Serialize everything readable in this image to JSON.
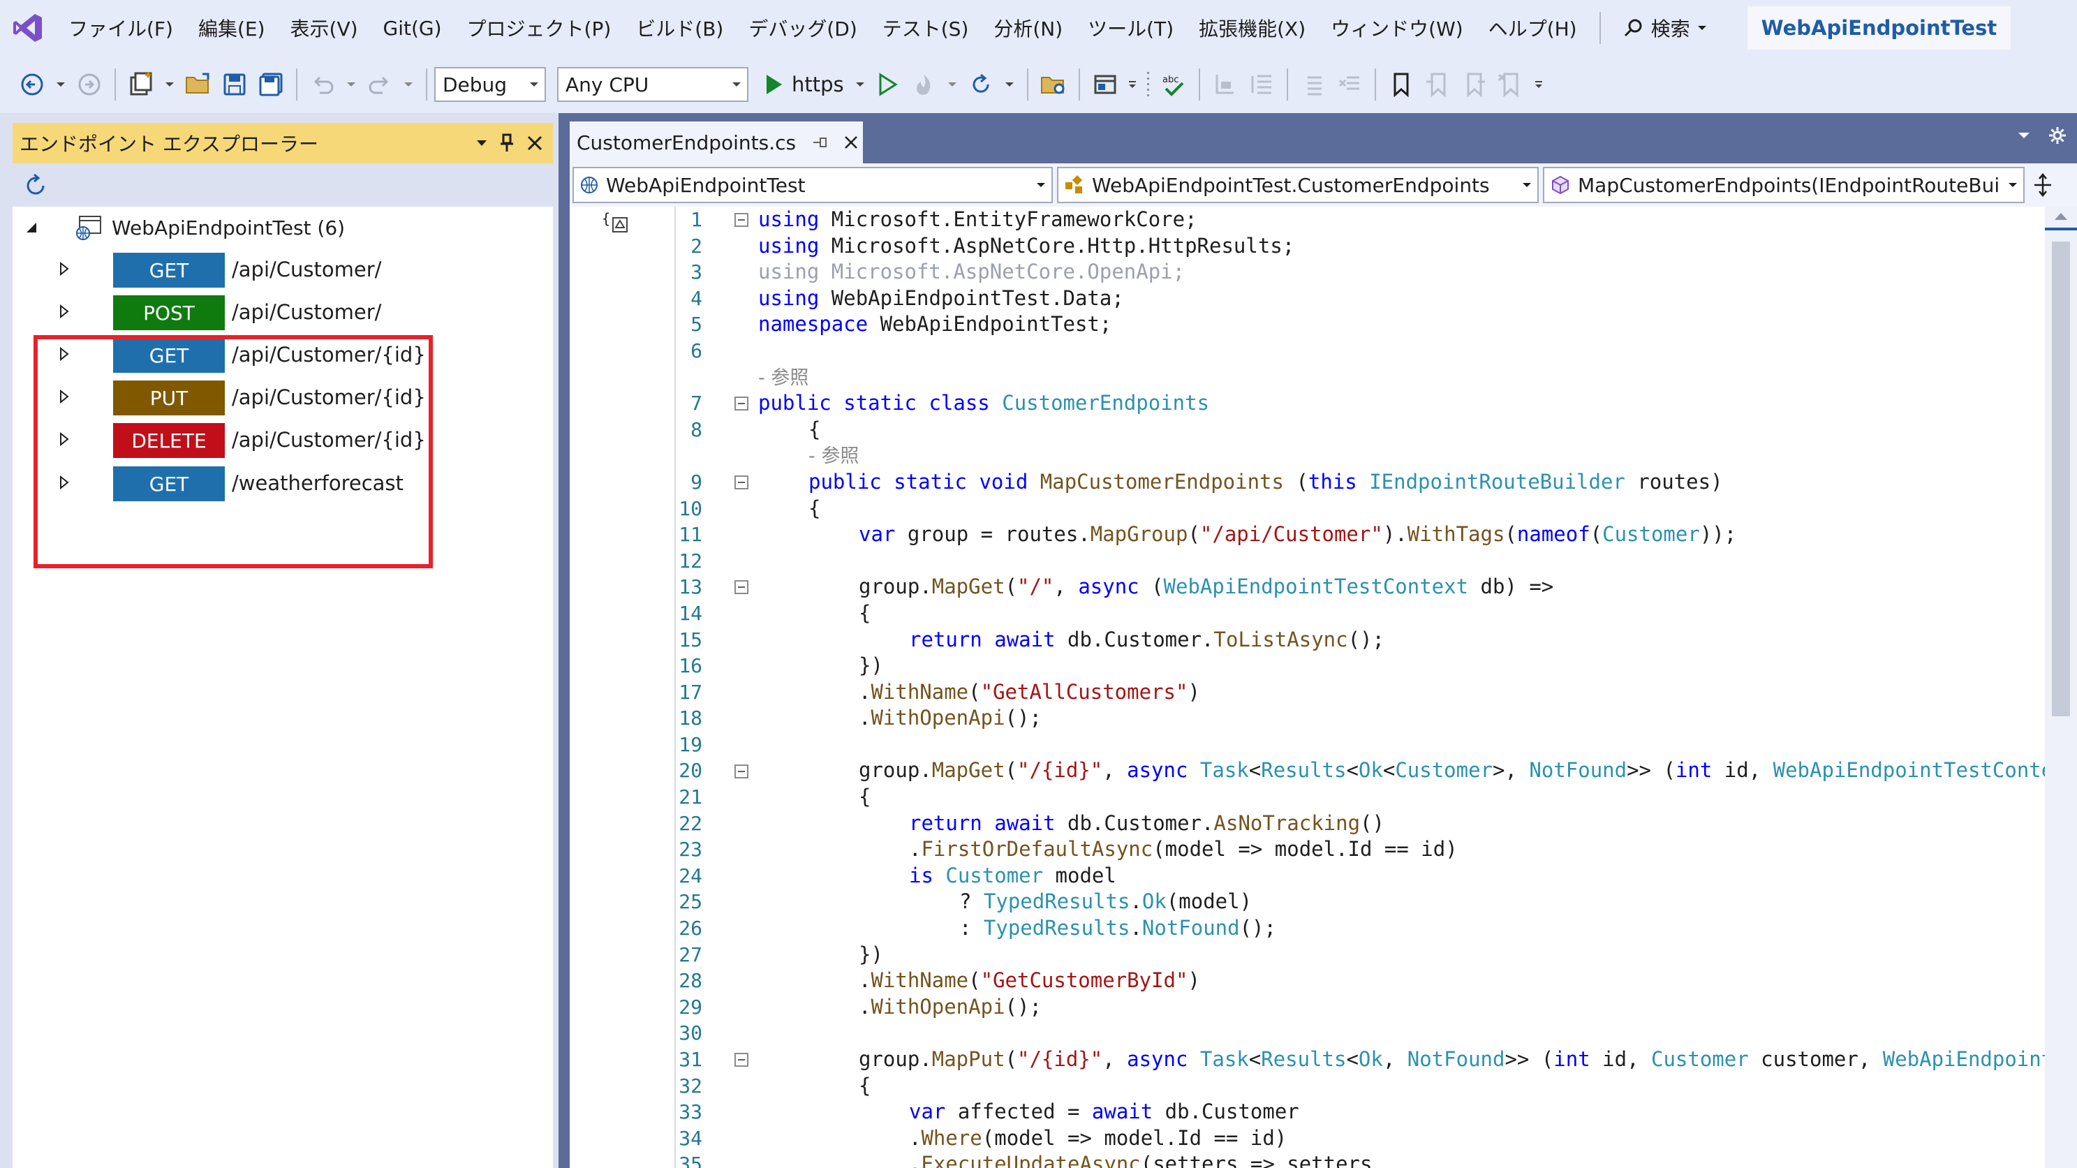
{
  "menu": {
    "items": [
      "ファイル(F)",
      "編集(E)",
      "表示(V)",
      "Git(G)",
      "プロジェクト(P)",
      "ビルド(B)",
      "デバッグ(D)",
      "テスト(S)",
      "分析(N)",
      "ツール(T)",
      "拡張機能(X)",
      "ウィンドウ(W)",
      "ヘルプ(H)"
    ],
    "search_label": "検索",
    "solution_name": "WebApiEndpointTest"
  },
  "toolbar": {
    "configuration": "Debug",
    "platform": "Any CPU",
    "run_profile": "https"
  },
  "endpoint_explorer": {
    "title": "エンドポイント エクスプローラー",
    "root_label": "WebApiEndpointTest (6)",
    "endpoints": [
      {
        "method": "GET",
        "path": "/api/Customer/",
        "color": "#1f6fad"
      },
      {
        "method": "POST",
        "path": "/api/Customer/",
        "color": "#0f7b0f"
      },
      {
        "method": "GET",
        "path": "/api/Customer/{id}",
        "color": "#1f6fad"
      },
      {
        "method": "PUT",
        "path": "/api/Customer/{id}",
        "color": "#805800"
      },
      {
        "method": "DELETE",
        "path": "/api/Customer/{id}",
        "color": "#c10f1a"
      },
      {
        "method": "GET",
        "path": "/weatherforecast",
        "color": "#1f6fad"
      }
    ]
  },
  "editor": {
    "tab_label": "CustomerEndpoints.cs",
    "nav_project": "WebApiEndpointTest",
    "nav_class": "WebApiEndpointTest.CustomerEndpoints",
    "nav_member": "MapCustomerEndpoints(IEndpointRouteBuilc",
    "ref_label": "- 参照",
    "lines": [
      {
        "n": "1",
        "text": "using Microsoft.EntityFrameworkCore;"
      },
      {
        "n": "2",
        "text": "using Microsoft.AspNetCore.Http.HttpResults;"
      },
      {
        "n": "3",
        "text": "using Microsoft.AspNetCore.OpenApi;"
      },
      {
        "n": "4",
        "text": "using WebApiEndpointTest.Data;"
      },
      {
        "n": "5",
        "text": "namespace WebApiEndpointTest;"
      },
      {
        "n": "6",
        "text": ""
      },
      {
        "n": "",
        "text": "- 参照"
      },
      {
        "n": "7",
        "text": "public static class CustomerEndpoints"
      },
      {
        "n": "8",
        "text": "{"
      },
      {
        "n": "",
        "text": "- 参照"
      },
      {
        "n": "9",
        "text": "public static void MapCustomerEndpoints (this IEndpointRouteBuilder routes)"
      },
      {
        "n": "10",
        "text": "{"
      },
      {
        "n": "11",
        "text": "var group = routes.MapGroup(\"/api/Customer\").WithTags(nameof(Customer));"
      },
      {
        "n": "12",
        "text": ""
      },
      {
        "n": "13",
        "text": "group.MapGet(\"/\", async (WebApiEndpointTestContext db) =>"
      },
      {
        "n": "14",
        "text": "{"
      },
      {
        "n": "15",
        "text": "return await db.Customer.ToListAsync();"
      },
      {
        "n": "16",
        "text": "})"
      },
      {
        "n": "17",
        "text": ".WithName(\"GetAllCustomers\")"
      },
      {
        "n": "18",
        "text": ".WithOpenApi();"
      },
      {
        "n": "19",
        "text": ""
      },
      {
        "n": "20",
        "text": "group.MapGet(\"/{id}\", async Task<Results<Ok<Customer>, NotFound>> (int id, WebApiEndpointTestContex"
      },
      {
        "n": "21",
        "text": "{"
      },
      {
        "n": "22",
        "text": "return await db.Customer.AsNoTracking()"
      },
      {
        "n": "23",
        "text": ".FirstOrDefaultAsync(model => model.Id == id)"
      },
      {
        "n": "24",
        "text": "is Customer model"
      },
      {
        "n": "25",
        "text": "? TypedResults.Ok(model)"
      },
      {
        "n": "26",
        "text": ": TypedResults.NotFound();"
      },
      {
        "n": "27",
        "text": "})"
      },
      {
        "n": "28",
        "text": ".WithName(\"GetCustomerById\")"
      },
      {
        "n": "29",
        "text": ".WithOpenApi();"
      },
      {
        "n": "30",
        "text": ""
      },
      {
        "n": "31",
        "text": "group.MapPut(\"/{id}\", async Task<Results<Ok, NotFound>> (int id, Customer customer, WebApiEndpointT"
      },
      {
        "n": "32",
        "text": "{"
      },
      {
        "n": "33",
        "text": "var affected = await db.Customer"
      },
      {
        "n": "34",
        "text": ".Where(model => model.Id == id)"
      },
      {
        "n": "35",
        "text": ".ExecuteUpdateAsync(setters => setters"
      }
    ]
  }
}
